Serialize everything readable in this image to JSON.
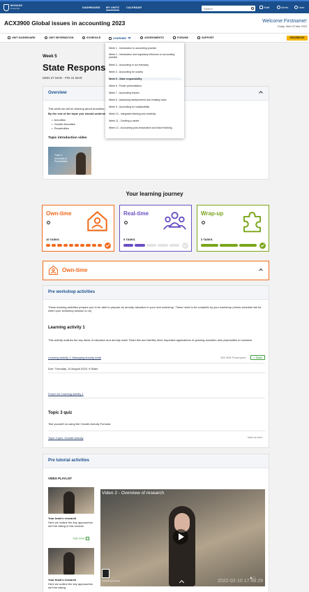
{
  "topbar": {
    "logo_name": "MONASH",
    "logo_sub": "University",
    "nav": [
      "DASHBOARD",
      "MY UNITS",
      "CALENDAR"
    ],
    "search_placeholder": "Search",
    "staff_label": "Staff",
    "alerts_label": "Alerts",
    "user_label": "User"
  },
  "header": {
    "course_title": "ACX3900 Global issues in accounting 2023",
    "welcome": "Welcome Firstname!",
    "today": "Today: Wed 23 Mar 2023"
  },
  "subnav": {
    "items": [
      "UNIT DASHBOARD",
      "UNIT INFORMATION",
      "SCHEDULE",
      "LEARNING",
      "ASSESSMENTS",
      "FORUMS",
      "SUPPORT"
    ],
    "gradebook": "GRADEBOOK"
  },
  "week": {
    "label": "Week 5",
    "title": "State Responsibility",
    "dates": "MON 27 MAR - FRI 31 MAR"
  },
  "dropdown": {
    "items": [
      "Week 1 - Introduction to accounting practice",
      "Week 2 - Introduction and regulatory influence on accounting practice",
      "Week 3 - Accounting in our everyday",
      "Week 4 - Accounting for society",
      "Week 5 - State responsibility",
      "Week 6 - Poster presentations",
      "Week 7 - Accounting futures",
      "Week 8 - Assessing measurement and creating value",
      "Week 9 - Accounting for sustainability",
      "Week 10 - Integrated thinking and creativity",
      "Week 11 - Creating a career",
      "Week 12 - Accounting post-reckonation and future thinking"
    ],
    "active_index": 4
  },
  "overview": {
    "title": "Overview",
    "intro": "This week we will be learning about Annuities and Perpetuities.",
    "objectives_heading": "By the end of the topic you should understand:",
    "bullets": [
      "Annuities",
      "Growth Annuities",
      "Perpetuities"
    ],
    "video_heading": "Topic introduction video",
    "video_caption_1": "Topic 3",
    "video_caption_2": "Annuities &",
    "video_caption_3": "Perpetuities"
  },
  "journey": {
    "title": "Your learning journey",
    "cards": [
      {
        "title": "Own-time",
        "tasks": "10 TASKS",
        "color": "#f26a1b",
        "done": 10,
        "total": 10,
        "icon": "house-person-icon"
      },
      {
        "title": "Real-time",
        "tasks": "5 TASKS",
        "color": "#6a4fc4",
        "done": 2,
        "total": 5,
        "icon": "group-icon"
      },
      {
        "title": "Wrap-up",
        "tasks": "3 TASKS",
        "color": "#7aa51a",
        "done": 3,
        "total": 3,
        "icon": "puzzle-icon"
      }
    ]
  },
  "owntime_bar": {
    "title": "Own-time"
  },
  "pre_workshop": {
    "title": "Pre workshop activities",
    "intro": "These learning activities prepare you to be able to prepare an annuity valuation in your next workshop. These need to be complete by your workshop (check schedule tab for when your workshop session is on)",
    "activity_title": "Learning activity 1",
    "activity_desc": "This activity outlines the key ideas of valuation and annuity math. Read this and identify three important applications of growing annuities and perpetuities in business.",
    "activity_link": "Learning activity 1: Managing annuity math",
    "file_info": "395.3KB Powerpoint",
    "done_label": "Done",
    "due": "Due: Thursday, 10 August 2023, 9:30am",
    "forum_link": "Forum for Learning activity 1",
    "quiz_title": "Topic 3 quiz",
    "quiz_desc": "Test yourself on using the Growth Annuity Formula",
    "quiz_link": "Topic 3 quiz: Growth Annuity",
    "mark_done": "Mark as done"
  },
  "pre_tutorial": {
    "title": "Pre tutorial activities",
    "playlist_label": "VIDEO PLAYLIST",
    "items": [
      {
        "title": "Your team's research",
        "desc": "Here we outline the key approaches we'll be taking in this module.",
        "status": "Topic done!"
      },
      {
        "title": "Your team's research",
        "desc": "Here we outline the key approaches we'll be taking"
      }
    ],
    "video_title": "Video 2 - Overview of research",
    "video_timestamp": "2022-02-10 17:48:29",
    "video_powered": "Powered by Panopto"
  }
}
